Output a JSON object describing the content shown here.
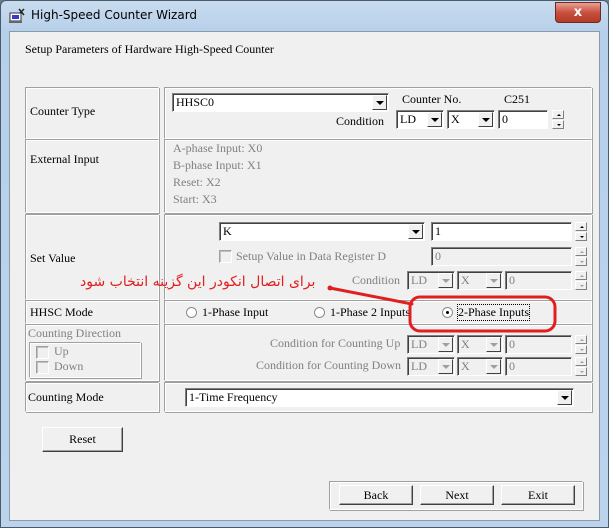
{
  "window": {
    "title": "High-Speed Counter Wizard",
    "icon": "app-icon",
    "close_label": "x"
  },
  "heading": "Setup Parameters of Hardware High-Speed Counter",
  "counter_type": {
    "label": "Counter Type",
    "value": "HHSC0",
    "counter_no_label": "Counter No.",
    "counter_no_value": "C251",
    "condition_label": "Condition",
    "condition_instr": "LD",
    "condition_device": "X",
    "condition_number": "0"
  },
  "external_input": {
    "label": "External Input",
    "lines": [
      "A-phase Input: X0",
      "B-phase Input: X1",
      "Reset: X2",
      "Start: X3"
    ]
  },
  "set_value": {
    "label": "Set Value",
    "type_value": "K",
    "value": "1",
    "register_checkbox_label": "Setup Value in Data Register D",
    "register_value": "0",
    "condition_label": "Condition",
    "condition_instr": "LD",
    "condition_device": "X",
    "condition_number": "0"
  },
  "annotation": {
    "text": "برای اتصال انکودر این گزینه انتخاب شود",
    "color": "#e02020"
  },
  "hhsc_mode": {
    "label": "HHSC Mode",
    "options": [
      {
        "label": "1-Phase Input",
        "selected": false
      },
      {
        "label": "1-Phase 2 Inputs",
        "selected": false
      },
      {
        "label": "2-Phase Inputs",
        "selected": true
      }
    ]
  },
  "counting_direction": {
    "label": "Counting Direction",
    "up_label": "Up",
    "down_label": "Down",
    "up_condition_label": "Condition for Counting Up",
    "up_instr": "LD",
    "up_device": "X",
    "up_number": "0",
    "down_condition_label": "Condition for Counting Down",
    "down_instr": "LD",
    "down_device": "X",
    "down_number": "0"
  },
  "counting_mode": {
    "label": "Counting Mode",
    "value": "1-Time Frequency"
  },
  "buttons": {
    "reset": "Reset",
    "back": "Back",
    "next": "Next",
    "exit": "Exit"
  }
}
